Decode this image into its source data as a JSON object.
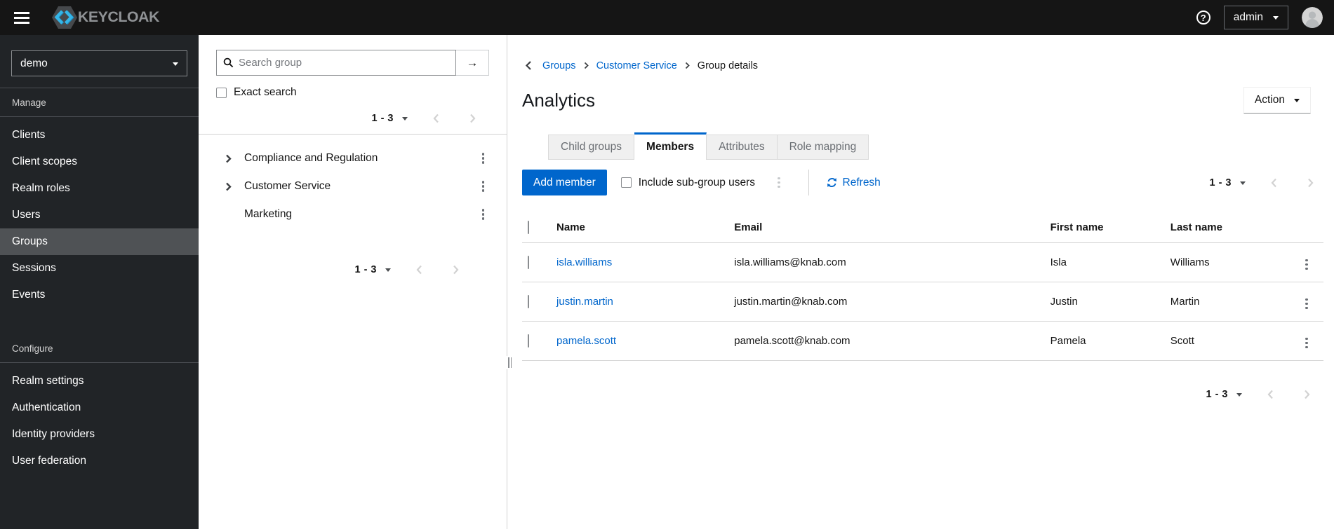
{
  "colors": {
    "primary": "#0066cc",
    "link": "#0066cc",
    "masthead_bg": "#151515",
    "sidebar_bg": "#212427",
    "sidebar_selected": "#4f5255",
    "tab_inactive_bg": "#f0f0f0"
  },
  "icons": {
    "help_glyph": "?",
    "search_submit_glyph": "→"
  },
  "masthead": {
    "brand": "KEYCLOAK",
    "username": "admin"
  },
  "sidebar": {
    "realm": "demo",
    "manage": {
      "label": "Manage",
      "items": [
        {
          "label": "Clients",
          "selected": false
        },
        {
          "label": "Client scopes",
          "selected": false
        },
        {
          "label": "Realm roles",
          "selected": false
        },
        {
          "label": "Users",
          "selected": false
        },
        {
          "label": "Groups",
          "selected": true
        },
        {
          "label": "Sessions",
          "selected": false
        },
        {
          "label": "Events",
          "selected": false
        }
      ]
    },
    "configure": {
      "label": "Configure",
      "items": [
        {
          "label": "Realm settings"
        },
        {
          "label": "Authentication"
        },
        {
          "label": "Identity providers"
        },
        {
          "label": "User federation"
        }
      ]
    }
  },
  "group_panel": {
    "search_placeholder": "Search group",
    "exact_search": "Exact search",
    "top_pagination": {
      "range": "1 - 3"
    },
    "tree": [
      {
        "label": "Compliance and Regulation",
        "expandable": true
      },
      {
        "label": "Customer Service",
        "expandable": true
      },
      {
        "label": "Marketing",
        "expandable": false
      }
    ],
    "bottom_pagination": {
      "range": "1 - 3"
    }
  },
  "main": {
    "breadcrumb": {
      "items": [
        {
          "label": "Groups",
          "link": true
        },
        {
          "label": "Customer Service",
          "link": true
        },
        {
          "label": "Group details",
          "link": false
        }
      ]
    },
    "title": "Analytics",
    "action": "Action",
    "tabs": [
      {
        "label": "Child groups",
        "active": false
      },
      {
        "label": "Members",
        "active": true
      },
      {
        "label": "Attributes",
        "active": false
      },
      {
        "label": "Role mapping",
        "active": false
      }
    ],
    "toolbar": {
      "add_member": "Add member",
      "include_subgroups": "Include sub-group users",
      "refresh": "Refresh",
      "pagination": {
        "range": "1 - 3"
      }
    },
    "table": {
      "headers": {
        "name": "Name",
        "email": "Email",
        "first": "First name",
        "last": "Last name"
      },
      "rows": [
        {
          "name": "isla.williams",
          "email": "isla.williams@knab.com",
          "first": "Isla",
          "last": "Williams"
        },
        {
          "name": "justin.martin",
          "email": "justin.martin@knab.com",
          "first": "Justin",
          "last": "Martin"
        },
        {
          "name": "pamela.scott",
          "email": "pamela.scott@knab.com",
          "first": "Pamela",
          "last": "Scott"
        }
      ]
    },
    "bottom_pagination": {
      "range": "1 - 3"
    }
  }
}
